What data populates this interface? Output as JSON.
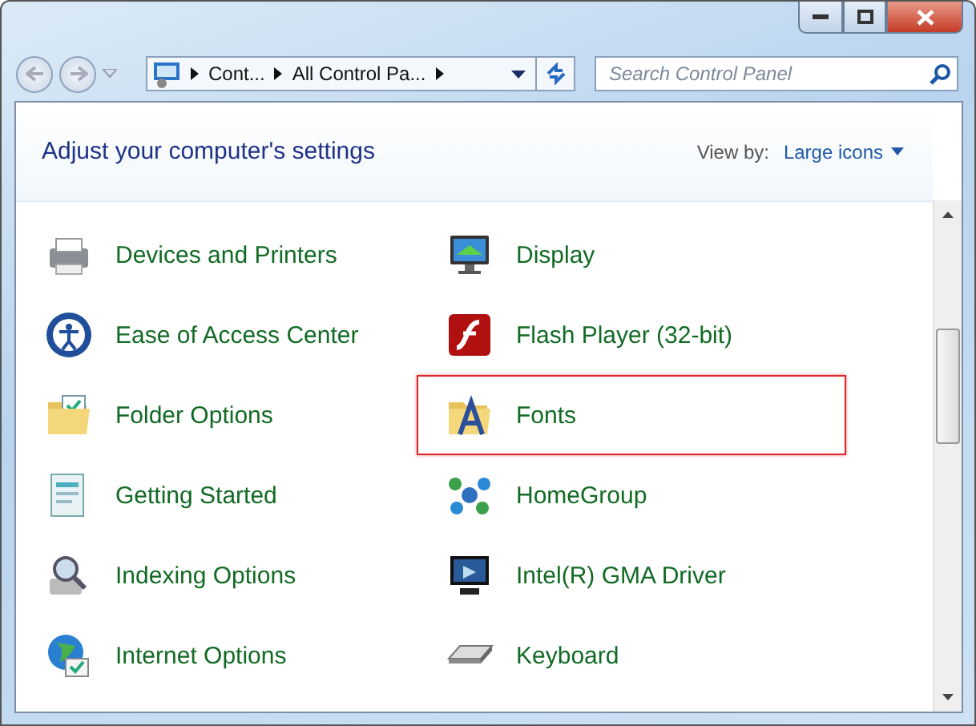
{
  "address_bar": {
    "crumbs": [
      "Cont...",
      "All Control Pa..."
    ]
  },
  "search": {
    "placeholder": "Search Control Panel"
  },
  "header": {
    "title": "Adjust your computer's settings",
    "view_by_label": "View by:",
    "view_by_value": "Large icons"
  },
  "items": [
    {
      "label": "Devices and Printers",
      "highlighted": false
    },
    {
      "label": "Display",
      "highlighted": false
    },
    {
      "label": "Ease of Access Center",
      "highlighted": false
    },
    {
      "label": "Flash Player (32-bit)",
      "highlighted": false
    },
    {
      "label": "Folder Options",
      "highlighted": false
    },
    {
      "label": "Fonts",
      "highlighted": true
    },
    {
      "label": "Getting Started",
      "highlighted": false
    },
    {
      "label": "HomeGroup",
      "highlighted": false
    },
    {
      "label": "Indexing Options",
      "highlighted": false
    },
    {
      "label": "Intel(R) GMA Driver",
      "highlighted": false
    },
    {
      "label": "Internet Options",
      "highlighted": false
    },
    {
      "label": "Keyboard",
      "highlighted": false
    }
  ]
}
